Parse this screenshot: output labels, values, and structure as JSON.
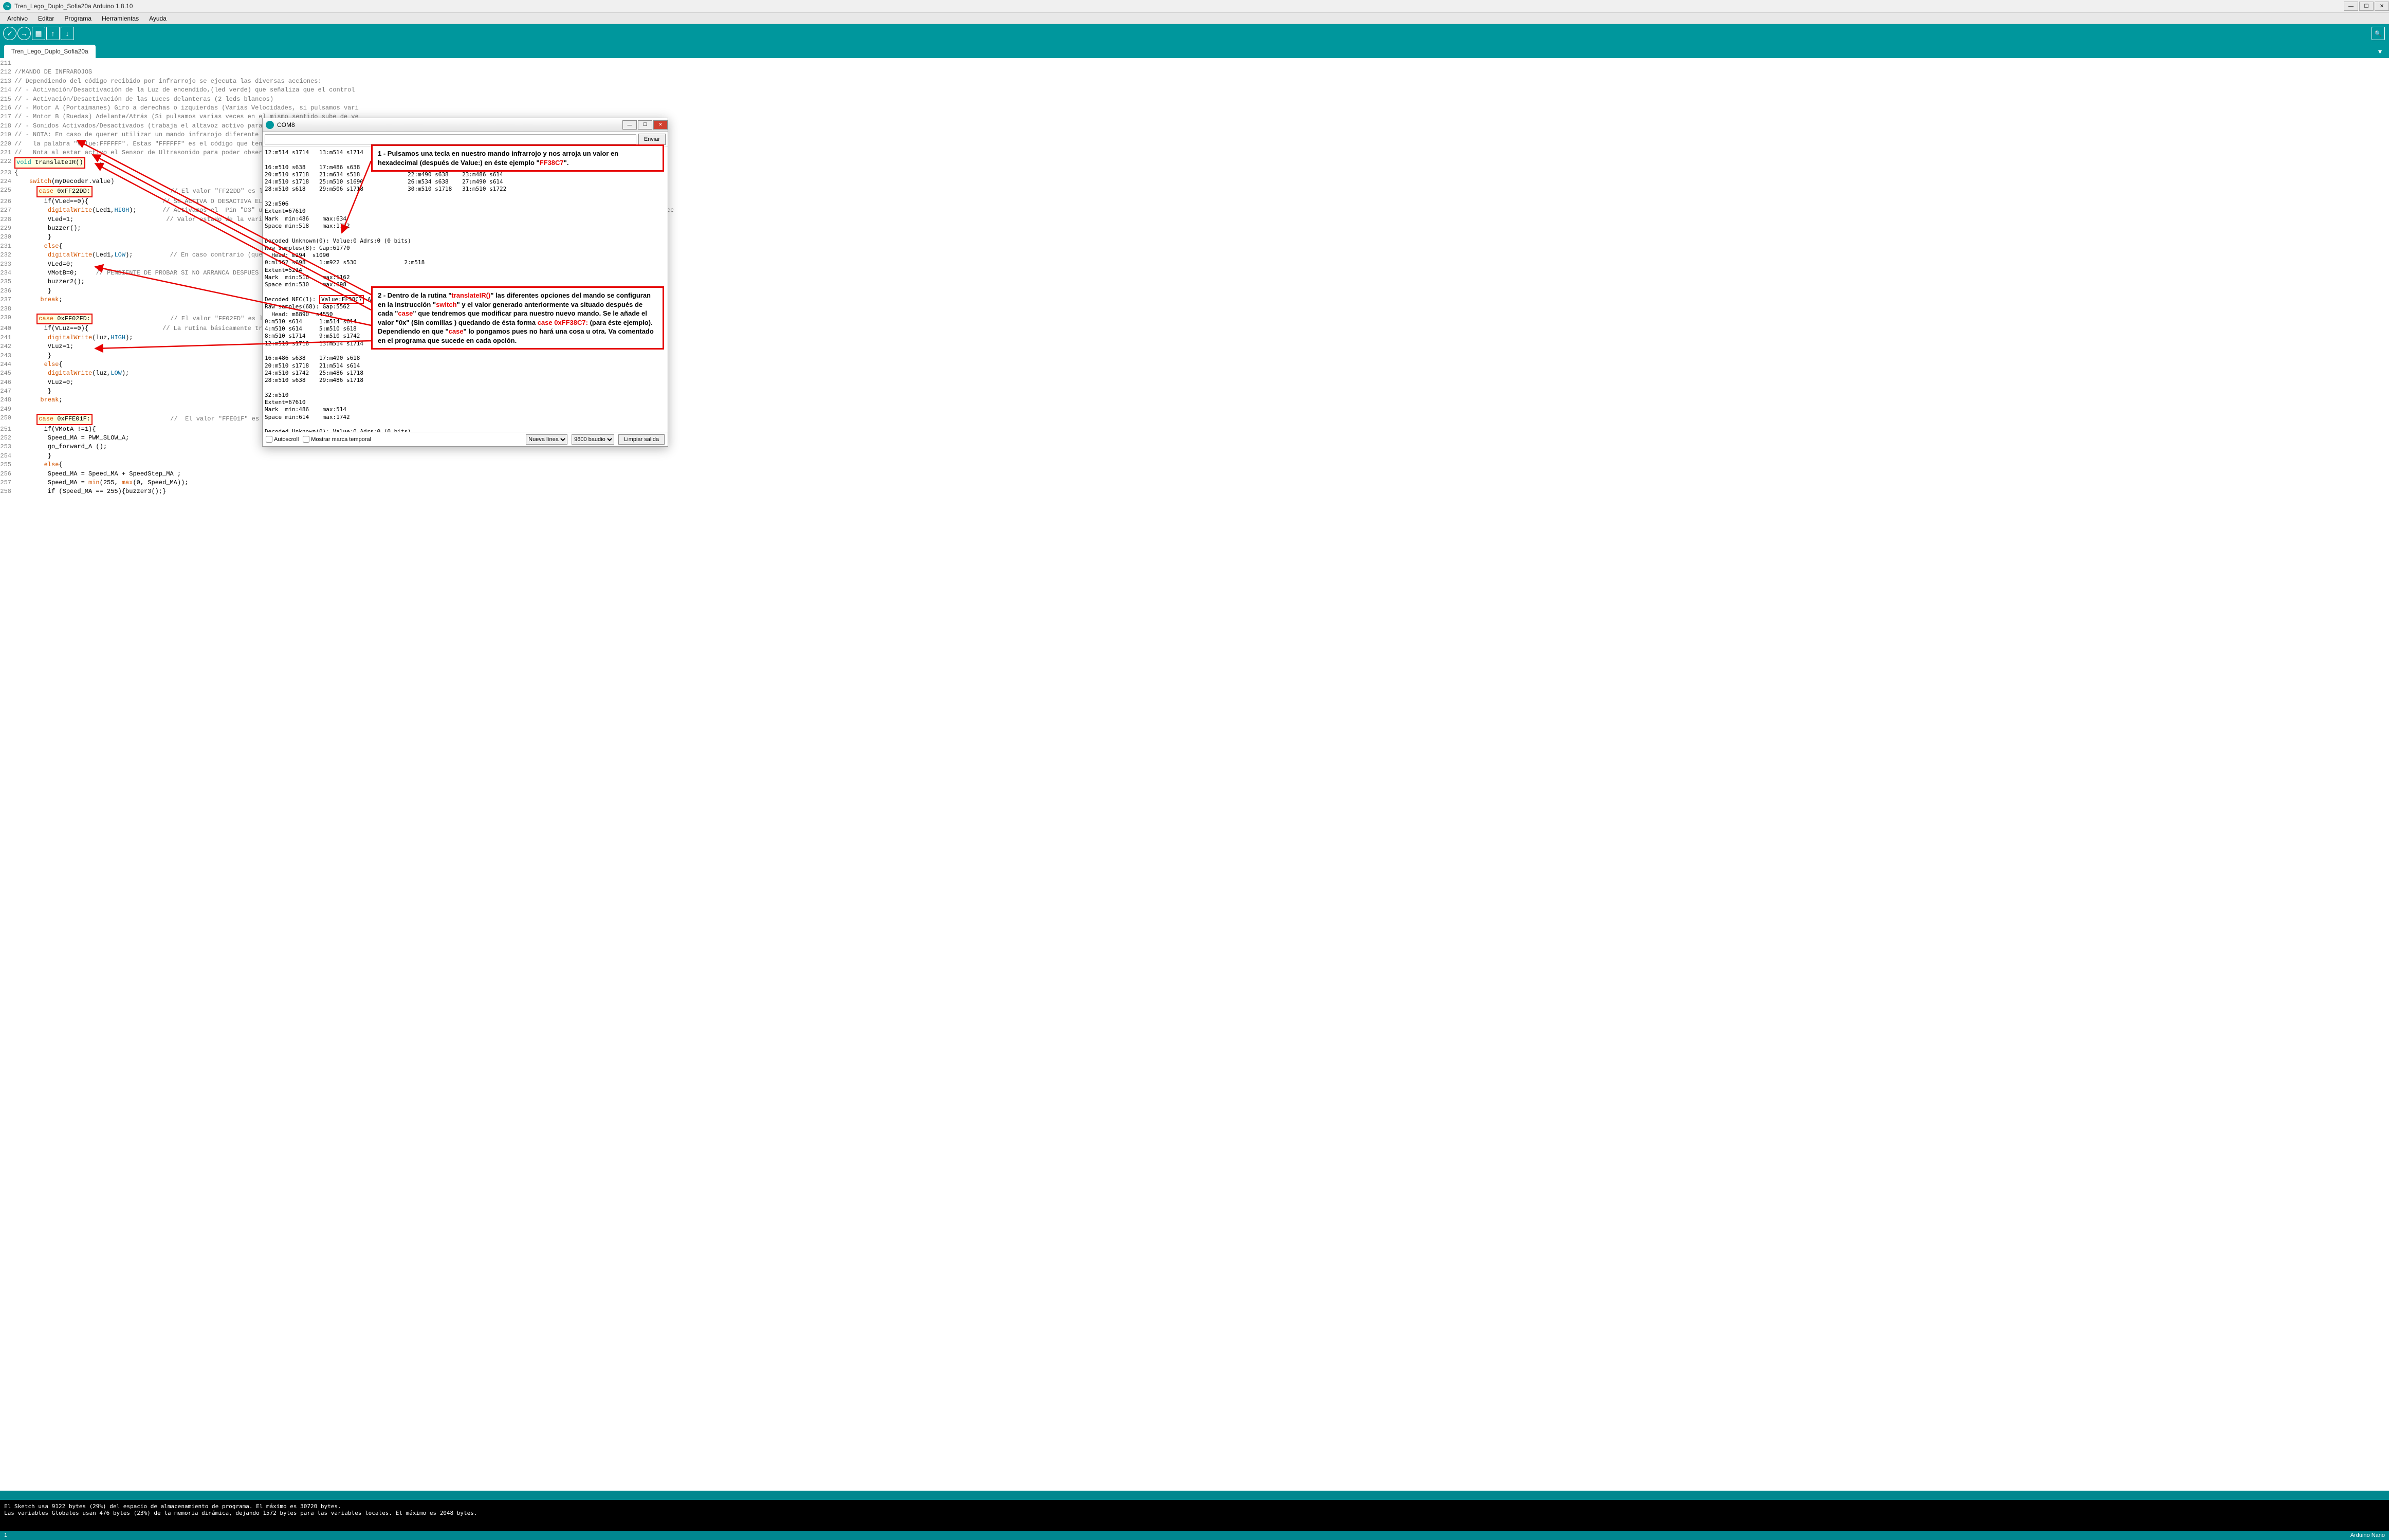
{
  "window": {
    "title": "Tren_Lego_Duplo_Sofia20a Arduino 1.8.10"
  },
  "menu": {
    "items": [
      "Archivo",
      "Editar",
      "Programa",
      "Herramientas",
      "Ayuda"
    ]
  },
  "tab": {
    "name": "Tren_Lego_Duplo_Sofia20a"
  },
  "toolbar": {
    "verify": "✓",
    "upload": "→",
    "new": "▦",
    "open": "↑",
    "save": "↓",
    "serial": "🔍"
  },
  "code_lines": [
    {
      "n": 211,
      "t": ""
    },
    {
      "n": 212,
      "t": "//MANDO DE INFRAROJOS",
      "cls": "c-comment"
    },
    {
      "n": 213,
      "t": "// Dependiendo del código recibido por infrarrojo se ejecuta las diversas acciones:",
      "cls": "c-comment"
    },
    {
      "n": 214,
      "t": "// - Activación/Desactivación de la Luz de encendido,(led verde) que señaliza que el control",
      "cls": "c-comment"
    },
    {
      "n": 215,
      "t": "// - Activación/Desactivación de las Luces delanteras (2 leds blancos)",
      "cls": "c-comment"
    },
    {
      "n": 216,
      "t": "// - Motor A (Portaimanes) Giro a derechas o izquierdas (Varias Velocidades, si pulsamos vari",
      "cls": "c-comment"
    },
    {
      "n": 217,
      "t": "// - Motor B (Ruedas) Adelante/Atrás (Si pulsamos varias veces en el mismo sentido sube de ve",
      "cls": "c-comment"
    },
    {
      "n": 218,
      "t": "// - Sonidos Activados/Desactivados (trabaja el altavoz activo para señalizar diversas accio",
      "cls": "c-comment"
    },
    {
      "n": 219,
      "t": "// - NOTA: En caso de querer utilizar un mando infrarojo diferente (quizás valdría uno de un",
      "cls": "c-comment"
    },
    {
      "n": 220,
      "t": "//   la palabra \"Value:FFFFFF\". Estas \"FFFFFF\" es el código que tendréis que poner a continu",
      "cls": "c-comment"
    },
    {
      "n": 221,
      "t": "//   Nota al estar activo el Sensor de Ultrasonido para poder observar el código obtenido de",
      "cls": "c-comment"
    },
    {
      "n": 222,
      "html": "<span class='hlbox'><span class='c-keyword'>void</span> translateIR()</span>    ←"
    },
    {
      "n": 223,
      "t": "{"
    },
    {
      "n": 224,
      "html": "    <span class='c-keyword2'>switch</span>(myDecoder.value)"
    },
    {
      "n": 225,
      "html": "      <span class='hlbox'><span class='c-keyword2'>case</span> 0xFF22DD:</span>                     <span class='c-comment'>// El valor \"FF22DD\" es la tecla \"Anterior\"</span>"
    },
    {
      "n": 226,
      "html": "        if(VLed==0){                    <span class='c-comment'>// SE ACTIVA O DESACTIVA EL \"LED VERDE\" \"Se</span>"
    },
    {
      "n": 227,
      "html": "         <span class='c-keyword2'>digitalWrite</span>(Led1,<span class='c-const'>HIGH</span>);       <span class='c-comment'>// Activamos el  Pin \"D3\" usado para activa</span>             <span class='c-comment' style='margin-left:520px'>e instrucc</span>"
    },
    {
      "n": 228,
      "html": "         VLed=1;                         <span class='c-comment'>// Valor estado de la variable activo ya qu</span>"
    },
    {
      "n": 229,
      "t": "         buzzer();"
    },
    {
      "n": 230,
      "t": "         }"
    },
    {
      "n": 231,
      "html": "        <span class='c-keyword2'>else</span>{"
    },
    {
      "n": 232,
      "html": "         <span class='c-keyword2'>digitalWrite</span>(Led1,<span class='c-const'>LOW</span>);          <span class='c-comment'>// En caso contrario (que VLed1 esté a 1),</span>"
    },
    {
      "n": 233,
      "t": "         VLed=0;"
    },
    {
      "n": 234,
      "html": "         VMotB=0;     <span class='c-comment'>// PENDIENTE DE PROBAR SI NO ARRANCA DESPUES DE ESTAR PARADO AL DESHA</span>"
    },
    {
      "n": 235,
      "t": "         buzzer2();"
    },
    {
      "n": 236,
      "t": "         }"
    },
    {
      "n": 237,
      "html": "       <span class='c-keyword2'>break</span>;"
    },
    {
      "n": 238,
      "t": ""
    },
    {
      "n": 239,
      "html": "      <span class='hlbox'><span class='c-keyword2'>case</span> 0xFF02FD:</span>                     <span class='c-comment'>// El valor \"FF02FD\" es la tecla \"Siguiente</span>"
    },
    {
      "n": 240,
      "html": "        if(VLuz==0){                    <span class='c-comment'>// La rutina básicamente trabaja que si le</span>"
    },
    {
      "n": 241,
      "html": "         <span class='c-keyword2'>digitalWrite</span>(luz,<span class='c-const'>HIGH</span>);"
    },
    {
      "n": 242,
      "t": "         VLuz=1;"
    },
    {
      "n": 243,
      "t": "         }"
    },
    {
      "n": 244,
      "html": "        <span class='c-keyword2'>else</span>{"
    },
    {
      "n": 245,
      "html": "         <span class='c-keyword2'>digitalWrite</span>(luz,<span class='c-const'>LOW</span>);"
    },
    {
      "n": 246,
      "t": "         VLuz=0;"
    },
    {
      "n": 247,
      "t": "         }"
    },
    {
      "n": 248,
      "html": "       <span class='c-keyword2'>break</span>;"
    },
    {
      "n": 249,
      "t": ""
    },
    {
      "n": 250,
      "html": "      <span class='hlbox'><span class='c-keyword2'>case</span> 0xFFE01F:</span>                     <span class='c-comment'>//  El valor \"FFE01F\" es la tecla \"-\" en el</span>"
    },
    {
      "n": 251,
      "t": "        if(VMotA !=1){"
    },
    {
      "n": 252,
      "t": "         Speed_MA = PWM_SLOW_A;"
    },
    {
      "n": 253,
      "t": "         go_forward_A ();"
    },
    {
      "n": 254,
      "t": "         }"
    },
    {
      "n": 255,
      "html": "        <span class='c-keyword2'>else</span>{"
    },
    {
      "n": 256,
      "t": "         Speed_MA = Speed_MA + SpeedStep_MA ;"
    },
    {
      "n": 257,
      "html": "         Speed_MA = <span class='c-keyword2'>min</span>(255, <span class='c-keyword2'>max</span>(0, Speed_MA));"
    },
    {
      "n": 258,
      "t": "         if (Speed_MA == 255){buzzer3();}"
    }
  ],
  "console": {
    "line1": "El Sketch usa 9122 bytes (29%) del espacio de almacenamiento de programa. El máximo es 30720 bytes.",
    "line2": "Las variables Globales usan 476 bytes (23%) de la memoria dinámica, dejando 1572 bytes para las variables locales. El máximo es 2048 bytes."
  },
  "status2": {
    "board": "Arduino Nano"
  },
  "serial": {
    "title": "COM8",
    "send_btn": "Enviar",
    "body": "12:m514 s1714   13:m514 s1714             14:m514 s1718   15:m510 s1718\n\n16:m510 s638    17:m486 s638              18:m490 s1718   19:m510 s1718\n20:m510 s1718   21:m634 s518              22:m490 s638    23:m486 s614\n24:m510 s1718   25:m510 s1690             26:m534 s638    27:m490 s614\n28:m510 s618    29:m506 s1718             30:m510 s1718   31:m510 s1722\n\n32:m506\nExtent=67610\nMark  min:486    max:634\nSpace min:518    max:1722\n\nDecoded Unknown(0): Value:0 Adrs:0 (0 bits)\nRaw samples(8): Gap:61770\n  Head: m294  s1090\n0:m1162 s698    1:m922 s530              2:m518\nExtent=5214\nMark  min:518    max:1162\nSpace min:530    max:698\n\nDecoded NEC(1): <span class='hlv'>Value:FF38C7</span> Adrs:0 (32 bits)\nRaw samples(68): Gap:5562\n  Head: m8890  s4550\n0:m510 s614     1:m514 s614              2:m510 s614    3:m514 s614\n4:m510 s614     5:m510 s618              6:m510 s614    7:m510 s618\n8:m510 s1714    9:m510 s1742             10:m486 s1718  11:m510 s1718\n12:m510 s1718   13:m514 s1714\n\n16:m486 s638    17:m490 s618\n20:m510 s1718   21:m514 s614\n24:m510 s1742   25:m486 s1718\n28:m510 s638    29:m486 s1718\n\n32:m510\nExtent=67610\nMark  min:486    max:514\nSpace min:614    max:1742\n\nDecoded Unknown(0): Value:0 Adrs:0 (0 bits)",
    "autoscroll": "Autoscroll",
    "timestamp": "Mostrar marca temporal",
    "lineend_opts": "Nueva línea",
    "baud_opts": "9600 baudio",
    "clear": "Limpiar salida"
  },
  "callout1": {
    "pre": "1 - Pulsamos una tecla en nuestro mando infrarrojo y nos arroja un valor en hexadecimal (después de Value:) en éste ejemplo \"",
    "hl": "FF38C7",
    "post": "\"."
  },
  "callout2": {
    "p1a": "2 - Dentro de la rutina \"",
    "p1h": "translateIR()",
    "p1b": "\" las diferentes opciones del mando se configuran en la instrucción \"",
    "p1h2": "switch",
    "p1c": "\" y el valor generado anteriormente va situado después de cada  \"",
    "p1h3": "case",
    "p1d": "\" que tendremos que modificar para nuestro nuevo mando. Se le añade el valor \"0x\" (Sin comillas ) quedando de ésta forma ",
    "p2h": "case 0xFF38C7:",
    "p2a": "  (para éste ejemplo). Dependiendo en que \"",
    "p2h2": "case",
    "p2b": "\" lo pongamos pues no hará una cosa u otra. Va comentado en el programa que sucede en cada opción."
  }
}
